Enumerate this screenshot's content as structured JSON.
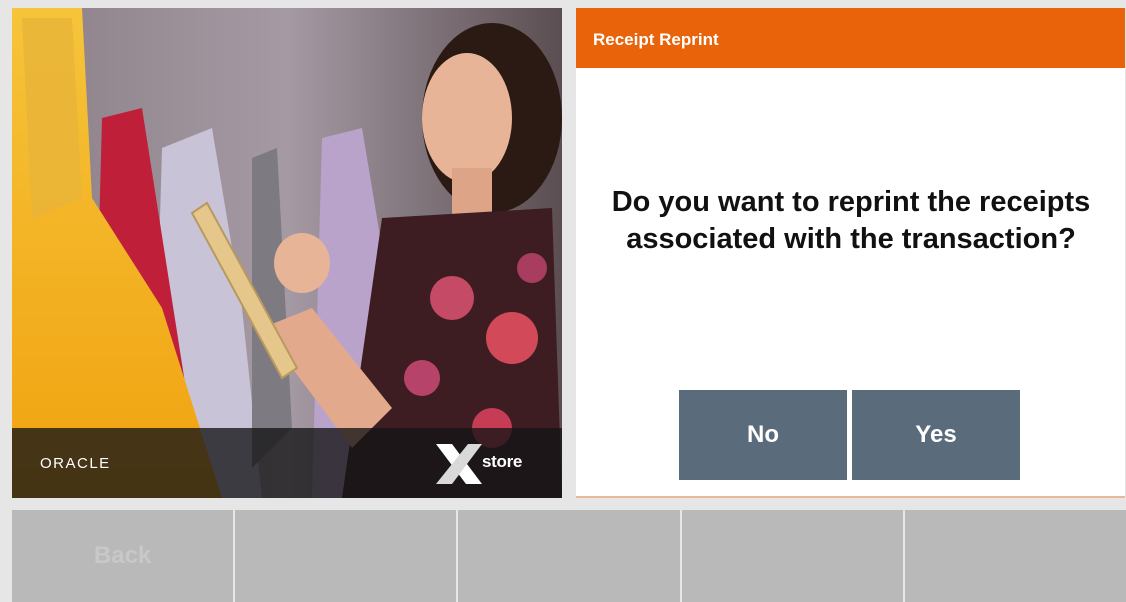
{
  "hero": {
    "oracle_logo": "ORACLE",
    "xstore_logo": "store"
  },
  "dialog": {
    "title": "Receipt Reprint",
    "message": "Do you want to reprint the receipts associated with the transaction?",
    "no_label": "No",
    "yes_label": "Yes"
  },
  "bottom_bar": {
    "buttons": [
      "Back",
      "",
      "",
      "",
      ""
    ]
  },
  "colors": {
    "header_orange": "#e8630a",
    "button_slate": "#5a6b7b",
    "bottom_bar_gray": "#b9b9b9"
  }
}
